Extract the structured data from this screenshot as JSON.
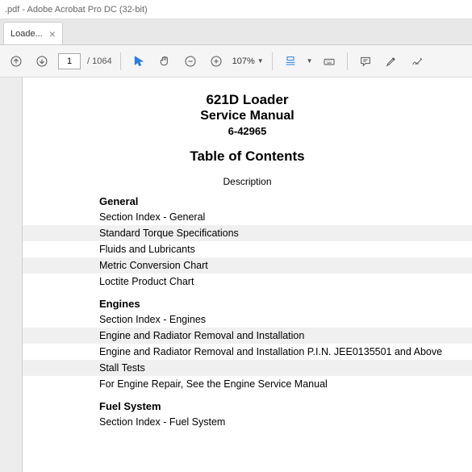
{
  "window": {
    "title": ".pdf - Adobe Acrobat Pro DC (32-bit)"
  },
  "tab": {
    "label": "Loade...",
    "close": "×"
  },
  "toolbar": {
    "page_current": "1",
    "page_total": "/ 1064",
    "zoom": "107%"
  },
  "doc": {
    "title1": "621D Loader",
    "title2": "Service Manual",
    "docnum": "6-42965",
    "toc": "Table of Contents",
    "description": "Description",
    "sections": [
      {
        "heading": "General",
        "rows": [
          "Section Index - General",
          "Standard Torque Specifications",
          "Fluids and Lubricants",
          "Metric Conversion Chart",
          "Loctite Product Chart"
        ]
      },
      {
        "heading": "Engines",
        "rows": [
          "Section Index - Engines",
          "Engine and Radiator Removal and Installation",
          "Engine and Radiator Removal and Installation P.I.N. JEE0135501 and Above",
          "Stall Tests",
          "For Engine Repair, See the Engine Service Manual"
        ]
      },
      {
        "heading": "Fuel System",
        "rows": [
          "Section Index - Fuel System"
        ]
      }
    ]
  }
}
